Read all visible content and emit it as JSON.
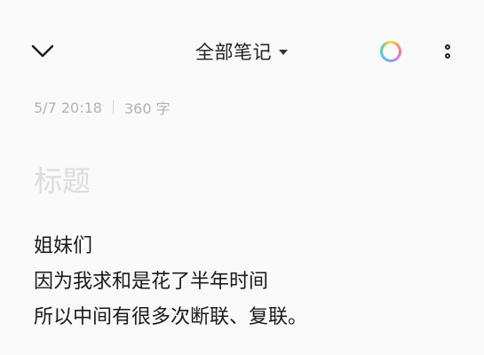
{
  "header": {
    "folder_label": "全部笔记"
  },
  "icons": {
    "back": "chevron-down-icon",
    "theme": "color-ring-icon",
    "more": "vertical-dots-icon"
  },
  "meta": {
    "date": "5/7 20:18",
    "word_count": "360 字"
  },
  "note": {
    "title_placeholder": "标题",
    "lines": [
      "姐妹们",
      "因为我求和是花了半年时间",
      "所以中间有很多次断联、复联。"
    ]
  }
}
